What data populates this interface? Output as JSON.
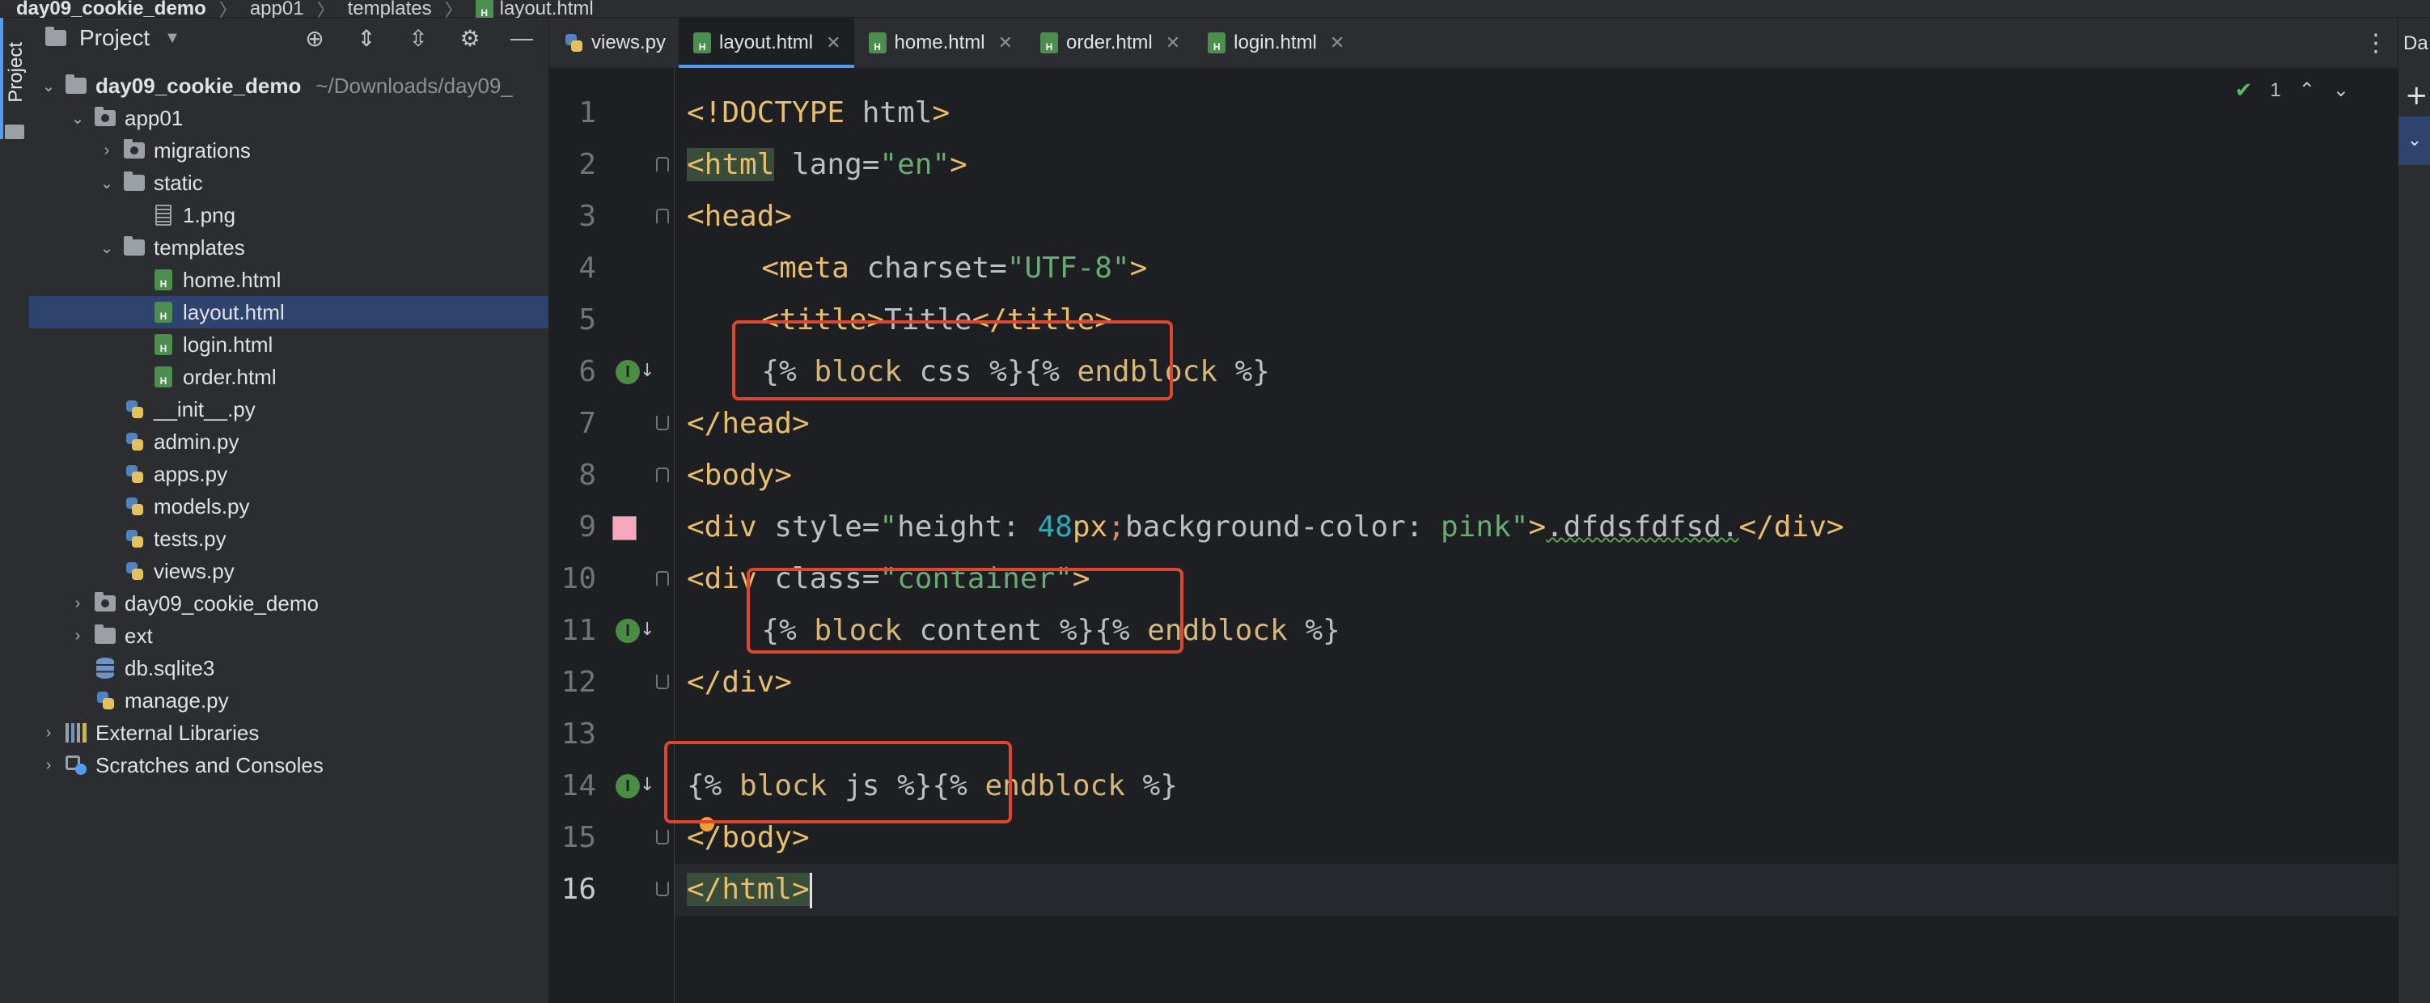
{
  "breadcrumb": {
    "project": "day09_cookie_demo",
    "app": "app01",
    "folder": "templates",
    "file": "layout.html"
  },
  "toolstrip": {
    "label": "Project"
  },
  "project_panel": {
    "title": "Project",
    "tree": [
      {
        "label": "day09_cookie_demo",
        "path_hint": "~/Downloads/day09_",
        "icon": "folder-icon",
        "arrow": "down"
      },
      {
        "label": "app01",
        "icon": "package-folder-icon",
        "arrow": "down"
      },
      {
        "label": "migrations",
        "icon": "package-folder-icon",
        "arrow": "right"
      },
      {
        "label": "static",
        "icon": "folder-icon",
        "arrow": "down"
      },
      {
        "label": "1.png",
        "icon": "image-file-icon",
        "arrow": ""
      },
      {
        "label": "templates",
        "icon": "folder-icon",
        "arrow": "down"
      },
      {
        "label": "home.html",
        "icon": "html-file-icon",
        "arrow": ""
      },
      {
        "label": "layout.html",
        "icon": "html-file-icon",
        "arrow": "",
        "selected": true
      },
      {
        "label": "login.html",
        "icon": "html-file-icon",
        "arrow": ""
      },
      {
        "label": "order.html",
        "icon": "html-file-icon",
        "arrow": ""
      },
      {
        "label": "__init__.py",
        "icon": "python-file-icon",
        "arrow": ""
      },
      {
        "label": "admin.py",
        "icon": "python-file-icon",
        "arrow": ""
      },
      {
        "label": "apps.py",
        "icon": "python-file-icon",
        "arrow": ""
      },
      {
        "label": "models.py",
        "icon": "python-file-icon",
        "arrow": ""
      },
      {
        "label": "tests.py",
        "icon": "python-file-icon",
        "arrow": ""
      },
      {
        "label": "views.py",
        "icon": "python-file-icon",
        "arrow": ""
      },
      {
        "label": "day09_cookie_demo",
        "icon": "package-folder-icon",
        "arrow": "right"
      },
      {
        "label": "ext",
        "icon": "folder-icon",
        "arrow": "right"
      },
      {
        "label": "db.sqlite3",
        "icon": "database-icon",
        "arrow": ""
      },
      {
        "label": "manage.py",
        "icon": "python-file-icon",
        "arrow": ""
      },
      {
        "label": "External Libraries",
        "icon": "libraries-icon",
        "arrow": "right"
      },
      {
        "label": "Scratches and Consoles",
        "icon": "scratches-icon",
        "arrow": "right"
      }
    ]
  },
  "tabs": [
    {
      "label": "views.py",
      "icon": "python-file-icon",
      "active": false
    },
    {
      "label": "layout.html",
      "icon": "html-file-icon",
      "active": true
    },
    {
      "label": "home.html",
      "icon": "html-file-icon",
      "active": false
    },
    {
      "label": "order.html",
      "icon": "html-file-icon",
      "active": false
    },
    {
      "label": "login.html",
      "icon": "html-file-icon",
      "active": false
    }
  ],
  "inspection": {
    "count": "1"
  },
  "right_strip": {
    "label": "Da"
  },
  "editor": {
    "line_numbers": [
      "1",
      "2",
      "3",
      "4",
      "5",
      "6",
      "7",
      "8",
      "9",
      "10",
      "11",
      "12",
      "13",
      "14",
      "15",
      "16"
    ],
    "current_line": 16,
    "lines": {
      "l1": {
        "open": "<!DOCTYPE",
        "rest": " html",
        "close": ">"
      },
      "l2": {
        "open": "<html",
        "attr": " lang=",
        "val": "\"en\"",
        "close": ">"
      },
      "l3": {
        "tag": "<head>"
      },
      "l4": {
        "open": "<meta",
        "attr": " charset=",
        "val": "\"UTF-8\"",
        "close": ">"
      },
      "l5": {
        "open": "<title>",
        "text": "Title",
        "close": "</title>"
      },
      "l6": {
        "a": "{% ",
        "kw": "block",
        "b": " css %}",
        "c": "{% ",
        "kw2": "endblock",
        "d": " %}"
      },
      "l7": {
        "tag": "</head>"
      },
      "l8": {
        "tag": "<body>"
      },
      "l9": {
        "open": "<div",
        "attr": " style=",
        "q1": "\"",
        "p1": "height: ",
        "num": "48",
        "unit": "px",
        "semi": ";",
        "p2": "background-color: ",
        "p3": "pink",
        "q2": "\"",
        "close": ">",
        "text": ".dfdsfdfsd.",
        "end": "</div>"
      },
      "l10": {
        "open": "<div",
        "attr": " class=",
        "val": "\"container\"",
        "close": ">"
      },
      "l11": {
        "a": "{% ",
        "kw": "block",
        "b": " content %}",
        "c": "{% ",
        "kw2": "endblock",
        "d": " %}"
      },
      "l12": {
        "tag": "</div>"
      },
      "l14": {
        "a": "{% ",
        "kw": "block",
        "b": " js %}",
        "c": "{% ",
        "kw2": "endblock",
        "d": " %}"
      },
      "l15": {
        "tag": "</body>"
      },
      "l16": {
        "tag": "</html>"
      }
    }
  },
  "colors": {
    "accent": "#4f9cf5",
    "highlight_box": "#e0452e",
    "swatch": "#f7a8bf"
  }
}
